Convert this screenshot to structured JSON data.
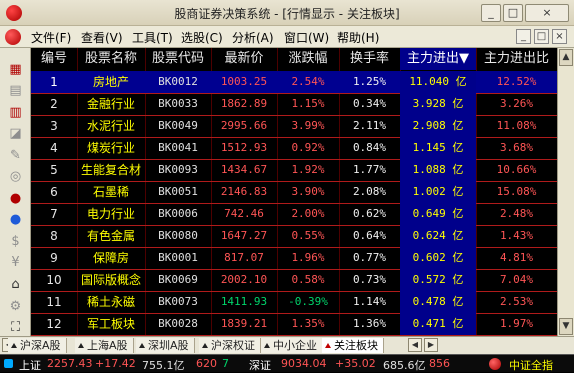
{
  "window": {
    "title": "股商证券决策系统 - [行情显示 - 关注板块]",
    "buttons": [
      "_",
      "□",
      "×"
    ]
  },
  "menu": {
    "items": [
      "文件(F)",
      "查看(V)",
      "工具(T)",
      "选股(C)",
      "分析(A)",
      "窗口(W)",
      "帮助(H)"
    ],
    "controls": [
      "_",
      "□",
      "×"
    ]
  },
  "toolbar": {
    "icons": [
      "grid-icon",
      "table-icon",
      "bar-chart-icon",
      "line-chart-icon",
      "edit-icon",
      "target-icon",
      "info-icon",
      "stock-icon",
      "money-icon",
      "yuan-icon",
      "home-icon",
      "settings-icon",
      "expand-icon"
    ]
  },
  "table": {
    "headers": [
      "编号",
      "股票名称",
      "股票代码",
      "最新价",
      "涨跌幅",
      "换手率",
      "主力进出▼",
      "主力进出比"
    ],
    "rows": [
      {
        "num": "1",
        "name": "房地产",
        "code": "BK0012",
        "price": "1003.25",
        "change": "2.54%",
        "turnover": "1.25%",
        "flow": "11.040 亿",
        "ratio": "12.52%"
      },
      {
        "num": "2",
        "name": "金融行业",
        "code": "BK0033",
        "price": "1862.89",
        "change": "1.15%",
        "turnover": "0.34%",
        "flow": "3.928 亿",
        "ratio": "3.26%"
      },
      {
        "num": "3",
        "name": "水泥行业",
        "code": "BK0049",
        "price": "2995.66",
        "change": "3.99%",
        "turnover": "2.11%",
        "flow": "2.908 亿",
        "ratio": "11.08%"
      },
      {
        "num": "4",
        "name": "煤炭行业",
        "code": "BK0041",
        "price": "1512.93",
        "change": "0.92%",
        "turnover": "0.84%",
        "flow": "1.145 亿",
        "ratio": "3.68%"
      },
      {
        "num": "5",
        "name": "生能复合材",
        "code": "BK0093",
        "price": "1434.67",
        "change": "1.92%",
        "turnover": "1.77%",
        "flow": "1.088 亿",
        "ratio": "10.66%"
      },
      {
        "num": "6",
        "name": "石墨稀",
        "code": "BK0051",
        "price": "2146.83",
        "change": "3.90%",
        "turnover": "2.08%",
        "flow": "1.002 亿",
        "ratio": "15.08%"
      },
      {
        "num": "7",
        "name": "电力行业",
        "code": "BK0006",
        "price": "742.46",
        "change": "2.00%",
        "turnover": "0.62%",
        "flow": "0.649 亿",
        "ratio": "2.48%"
      },
      {
        "num": "8",
        "name": "有色金属",
        "code": "BK0080",
        "price": "1647.27",
        "change": "0.55%",
        "turnover": "0.64%",
        "flow": "0.624 亿",
        "ratio": "1.43%"
      },
      {
        "num": "9",
        "name": "保障房",
        "code": "BK0001",
        "price": "817.07",
        "change": "1.96%",
        "turnover": "0.77%",
        "flow": "0.602 亿",
        "ratio": "4.81%"
      },
      {
        "num": "10",
        "name": "国际版概念",
        "code": "BK0069",
        "price": "2002.10",
        "change": "0.58%",
        "turnover": "0.73%",
        "flow": "0.572 亿",
        "ratio": "7.04%"
      },
      {
        "num": "11",
        "name": "稀土永磁",
        "code": "BK0073",
        "price": "1411.93",
        "change": "-0.39%",
        "turnover": "1.14%",
        "flow": "0.478 亿",
        "ratio": "2.53%"
      },
      {
        "num": "12",
        "name": "军工板块",
        "code": "BK0028",
        "price": "1839.21",
        "change": "1.35%",
        "turnover": "1.36%",
        "flow": "0.471 亿",
        "ratio": "1.97%"
      }
    ]
  },
  "tabs": {
    "items": [
      "沪深A股",
      "上海A股",
      "深圳A股",
      "沪深权证",
      "中小企业",
      "关注板块"
    ]
  },
  "status": {
    "sh_label": "上证",
    "sh_value": "2257.43",
    "sh_change": "+17.42",
    "sh_volume": "755.1亿",
    "sh_up": "620",
    "sh_down": "7",
    "sz_label": "深证",
    "sz_value": "9034.04",
    "sz_change": "+35.02",
    "sz_volume": "685.6亿",
    "sz_up": "856",
    "right_label": "中证全指"
  },
  "colors": {
    "up": "#ff5555",
    "down": "#00d36a",
    "name": "#ffff00",
    "selected": "#00008b"
  }
}
